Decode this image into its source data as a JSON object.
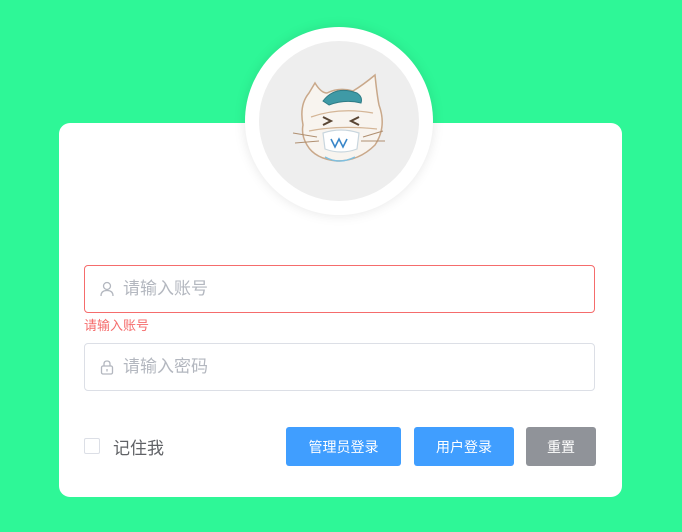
{
  "login": {
    "account": {
      "placeholder": "请输入账号",
      "value": "",
      "error": "请输入账号",
      "icon": "user-icon"
    },
    "password": {
      "placeholder": "请输入密码",
      "value": "",
      "icon": "lock-icon"
    },
    "remember_label": "记住我",
    "buttons": {
      "admin_login": "管理员登录",
      "user_login": "用户登录",
      "reset": "重置"
    }
  },
  "colors": {
    "background": "#2ef797",
    "primary": "#409eff",
    "info": "#909399",
    "error": "#f56c6c"
  }
}
